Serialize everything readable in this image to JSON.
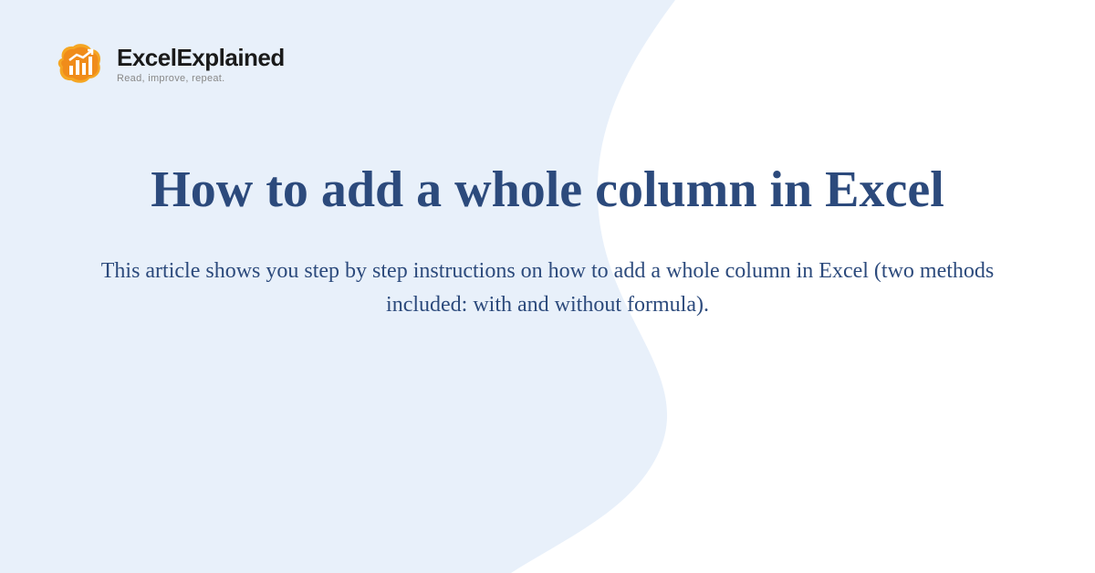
{
  "logo": {
    "title": "ExcelExplained",
    "tagline": "Read, improve, repeat."
  },
  "article": {
    "headline": "How to add a whole column in Excel",
    "description": "This article shows you step by step instructions on how to add a whole column in Excel (two methods included: with and without formula)."
  }
}
